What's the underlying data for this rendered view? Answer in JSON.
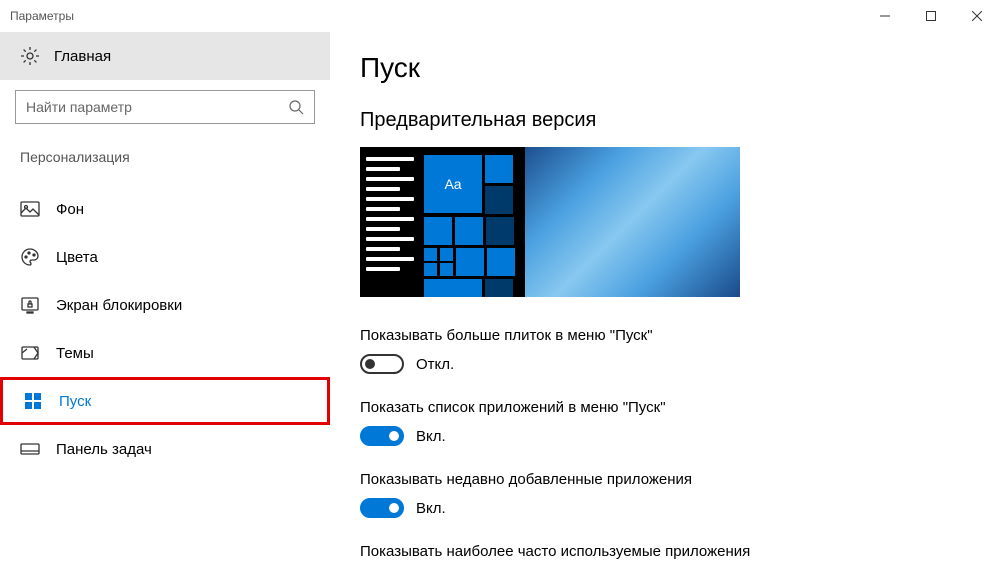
{
  "window": {
    "title": "Параметры"
  },
  "sidebar": {
    "home": "Главная",
    "search_placeholder": "Найти параметр",
    "category": "Персонализация",
    "items": [
      {
        "label": "Фон",
        "icon": "picture-icon"
      },
      {
        "label": "Цвета",
        "icon": "palette-icon"
      },
      {
        "label": "Экран блокировки",
        "icon": "lockscreen-icon"
      },
      {
        "label": "Темы",
        "icon": "themes-icon"
      },
      {
        "label": "Пуск",
        "icon": "start-icon",
        "active": true,
        "highlighted": true
      },
      {
        "label": "Панель задач",
        "icon": "taskbar-icon"
      }
    ]
  },
  "main": {
    "title": "Пуск",
    "preview_heading": "Предварительная версия",
    "preview_tile_text": "Aa",
    "settings": [
      {
        "label": "Показывать больше плиток в меню \"Пуск\"",
        "state": "off",
        "state_label": "Откл."
      },
      {
        "label": "Показать список приложений в меню \"Пуск\"",
        "state": "on",
        "state_label": "Вкл."
      },
      {
        "label": "Показывать недавно добавленные приложения",
        "state": "on",
        "state_label": "Вкл."
      },
      {
        "label": "Показывать наиболее часто используемые приложения",
        "state": "",
        "state_label": ""
      }
    ]
  }
}
